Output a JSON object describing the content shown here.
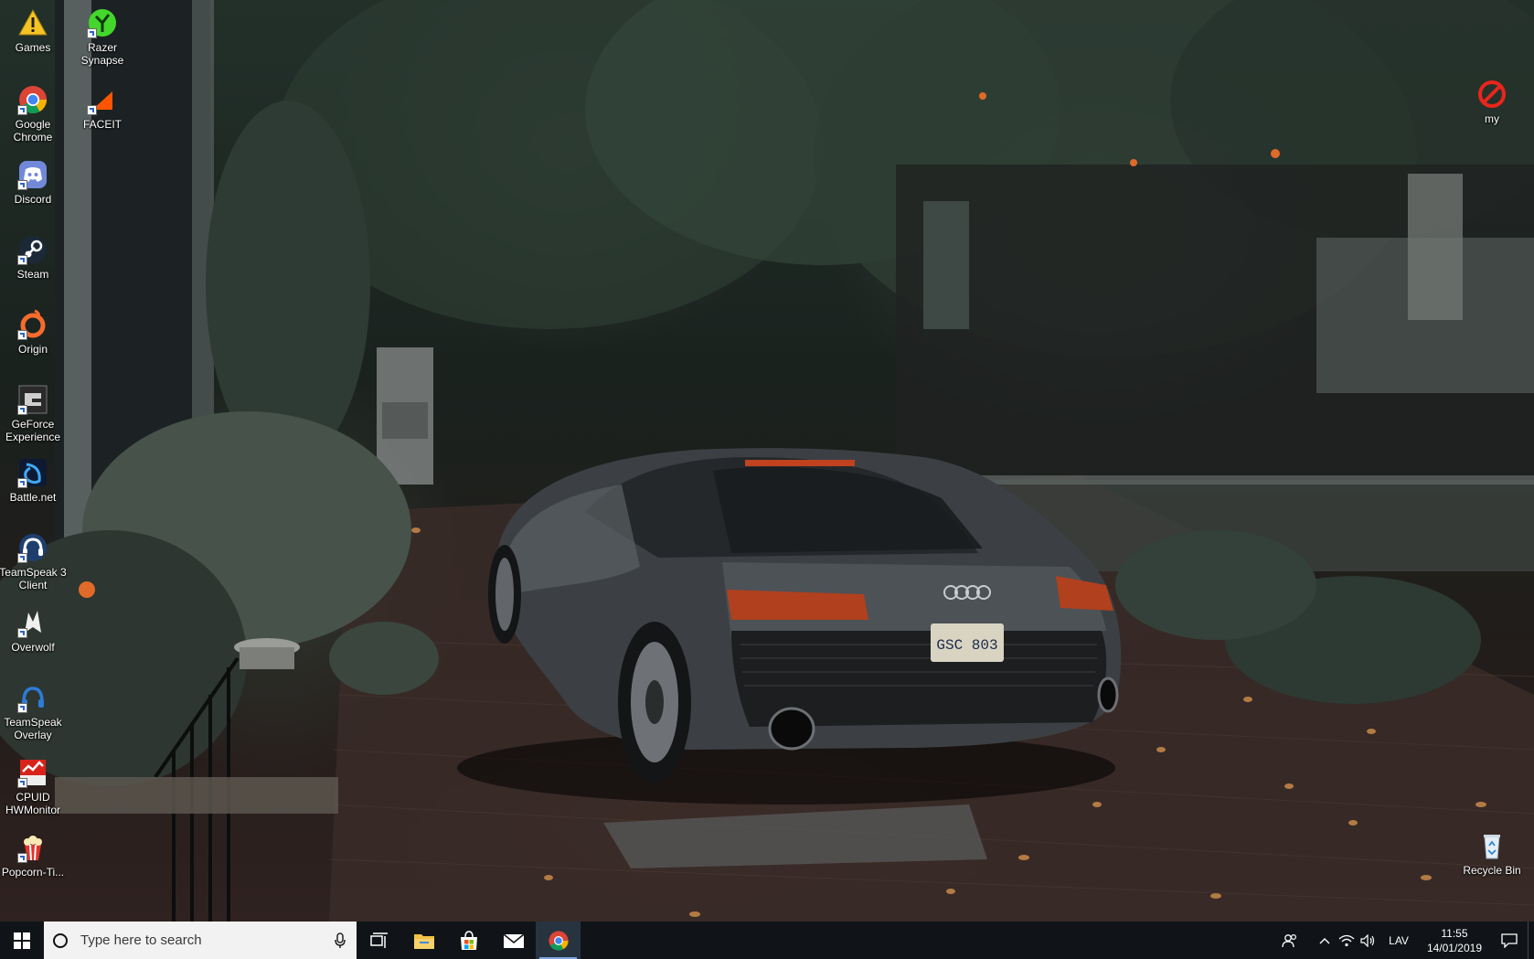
{
  "desktop": {
    "left_column": [
      {
        "label": "Games",
        "icon": "warning-folder-icon"
      },
      {
        "label": "Google Chrome",
        "icon": "chrome-icon"
      },
      {
        "label": "Discord",
        "icon": "discord-icon"
      },
      {
        "label": "Steam",
        "icon": "steam-icon"
      },
      {
        "label": "Origin",
        "icon": "origin-icon"
      },
      {
        "label": "GeForce Experience",
        "icon": "geforce-icon"
      },
      {
        "label": "Battle.net",
        "icon": "battlenet-icon"
      },
      {
        "label": "TeamSpeak 3 Client",
        "icon": "teamspeak-icon"
      },
      {
        "label": "Overwolf",
        "icon": "overwolf-icon"
      },
      {
        "label": "TeamSpeak Overlay",
        "icon": "teamspeak-overlay-icon"
      },
      {
        "label": "CPUID HWMonitor",
        "icon": "hwmonitor-icon"
      },
      {
        "label": "Popcorn-Ti...",
        "icon": "popcorn-icon"
      }
    ],
    "second_column": [
      {
        "label": "Razer Synapse",
        "icon": "razer-icon"
      },
      {
        "label": "FACEIT",
        "icon": "faceit-icon"
      }
    ],
    "right_column": [
      {
        "label": "my",
        "icon": "no-entry-icon"
      },
      {
        "label": "Recycle Bin",
        "icon": "recycle-bin-icon"
      }
    ]
  },
  "taskbar": {
    "search_placeholder": "Type here to search",
    "pinned": [
      {
        "name": "task-view",
        "icon": "task-view-icon"
      },
      {
        "name": "file-explorer",
        "icon": "folder-icon"
      },
      {
        "name": "store",
        "icon": "store-icon"
      },
      {
        "name": "mail",
        "icon": "mail-icon"
      },
      {
        "name": "chrome",
        "icon": "chrome-icon",
        "active": true
      }
    ],
    "tray": {
      "language": "LAV",
      "time": "11:55",
      "date": "14/01/2019"
    }
  },
  "colors": {
    "taskbar": "#101418",
    "search_bg": "#f2f2f2",
    "active_indicator": "#7aa7dc"
  }
}
